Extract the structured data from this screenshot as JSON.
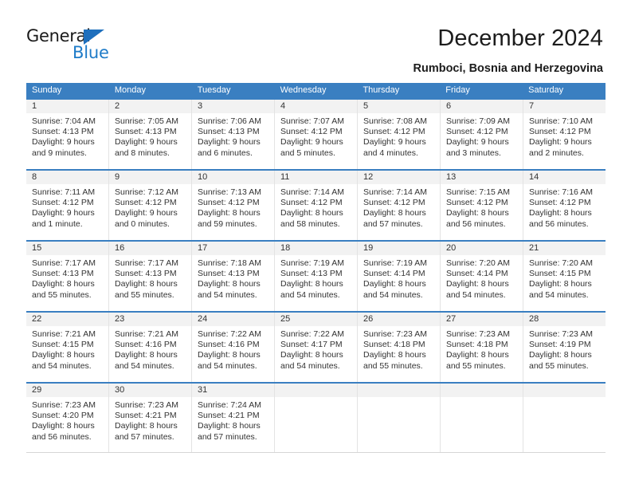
{
  "brand": {
    "name_part1": "General",
    "name_part2": "Blue",
    "triangle_icon": "triangle-icon",
    "colors": {
      "dark": "#1a1a1a",
      "blue": "#1e7bc8"
    }
  },
  "header": {
    "title": "December 2024",
    "subtitle": "Rumboci, Bosnia and Herzegovina"
  },
  "calendar": {
    "accent_color": "#3a7fc1",
    "day_bar_color": "#f2f2f2",
    "weekdays": [
      "Sunday",
      "Monday",
      "Tuesday",
      "Wednesday",
      "Thursday",
      "Friday",
      "Saturday"
    ],
    "weeks": [
      {
        "days": [
          {
            "number": "1",
            "sunrise": "Sunrise: 7:04 AM",
            "sunset": "Sunset: 4:13 PM",
            "daylight_line1": "Daylight: 9 hours",
            "daylight_line2": "and 9 minutes."
          },
          {
            "number": "2",
            "sunrise": "Sunrise: 7:05 AM",
            "sunset": "Sunset: 4:13 PM",
            "daylight_line1": "Daylight: 9 hours",
            "daylight_line2": "and 8 minutes."
          },
          {
            "number": "3",
            "sunrise": "Sunrise: 7:06 AM",
            "sunset": "Sunset: 4:13 PM",
            "daylight_line1": "Daylight: 9 hours",
            "daylight_line2": "and 6 minutes."
          },
          {
            "number": "4",
            "sunrise": "Sunrise: 7:07 AM",
            "sunset": "Sunset: 4:12 PM",
            "daylight_line1": "Daylight: 9 hours",
            "daylight_line2": "and 5 minutes."
          },
          {
            "number": "5",
            "sunrise": "Sunrise: 7:08 AM",
            "sunset": "Sunset: 4:12 PM",
            "daylight_line1": "Daylight: 9 hours",
            "daylight_line2": "and 4 minutes."
          },
          {
            "number": "6",
            "sunrise": "Sunrise: 7:09 AM",
            "sunset": "Sunset: 4:12 PM",
            "daylight_line1": "Daylight: 9 hours",
            "daylight_line2": "and 3 minutes."
          },
          {
            "number": "7",
            "sunrise": "Sunrise: 7:10 AM",
            "sunset": "Sunset: 4:12 PM",
            "daylight_line1": "Daylight: 9 hours",
            "daylight_line2": "and 2 minutes."
          }
        ]
      },
      {
        "days": [
          {
            "number": "8",
            "sunrise": "Sunrise: 7:11 AM",
            "sunset": "Sunset: 4:12 PM",
            "daylight_line1": "Daylight: 9 hours",
            "daylight_line2": "and 1 minute."
          },
          {
            "number": "9",
            "sunrise": "Sunrise: 7:12 AM",
            "sunset": "Sunset: 4:12 PM",
            "daylight_line1": "Daylight: 9 hours",
            "daylight_line2": "and 0 minutes."
          },
          {
            "number": "10",
            "sunrise": "Sunrise: 7:13 AM",
            "sunset": "Sunset: 4:12 PM",
            "daylight_line1": "Daylight: 8 hours",
            "daylight_line2": "and 59 minutes."
          },
          {
            "number": "11",
            "sunrise": "Sunrise: 7:14 AM",
            "sunset": "Sunset: 4:12 PM",
            "daylight_line1": "Daylight: 8 hours",
            "daylight_line2": "and 58 minutes."
          },
          {
            "number": "12",
            "sunrise": "Sunrise: 7:14 AM",
            "sunset": "Sunset: 4:12 PM",
            "daylight_line1": "Daylight: 8 hours",
            "daylight_line2": "and 57 minutes."
          },
          {
            "number": "13",
            "sunrise": "Sunrise: 7:15 AM",
            "sunset": "Sunset: 4:12 PM",
            "daylight_line1": "Daylight: 8 hours",
            "daylight_line2": "and 56 minutes."
          },
          {
            "number": "14",
            "sunrise": "Sunrise: 7:16 AM",
            "sunset": "Sunset: 4:12 PM",
            "daylight_line1": "Daylight: 8 hours",
            "daylight_line2": "and 56 minutes."
          }
        ]
      },
      {
        "days": [
          {
            "number": "15",
            "sunrise": "Sunrise: 7:17 AM",
            "sunset": "Sunset: 4:13 PM",
            "daylight_line1": "Daylight: 8 hours",
            "daylight_line2": "and 55 minutes."
          },
          {
            "number": "16",
            "sunrise": "Sunrise: 7:17 AM",
            "sunset": "Sunset: 4:13 PM",
            "daylight_line1": "Daylight: 8 hours",
            "daylight_line2": "and 55 minutes."
          },
          {
            "number": "17",
            "sunrise": "Sunrise: 7:18 AM",
            "sunset": "Sunset: 4:13 PM",
            "daylight_line1": "Daylight: 8 hours",
            "daylight_line2": "and 54 minutes."
          },
          {
            "number": "18",
            "sunrise": "Sunrise: 7:19 AM",
            "sunset": "Sunset: 4:13 PM",
            "daylight_line1": "Daylight: 8 hours",
            "daylight_line2": "and 54 minutes."
          },
          {
            "number": "19",
            "sunrise": "Sunrise: 7:19 AM",
            "sunset": "Sunset: 4:14 PM",
            "daylight_line1": "Daylight: 8 hours",
            "daylight_line2": "and 54 minutes."
          },
          {
            "number": "20",
            "sunrise": "Sunrise: 7:20 AM",
            "sunset": "Sunset: 4:14 PM",
            "daylight_line1": "Daylight: 8 hours",
            "daylight_line2": "and 54 minutes."
          },
          {
            "number": "21",
            "sunrise": "Sunrise: 7:20 AM",
            "sunset": "Sunset: 4:15 PM",
            "daylight_line1": "Daylight: 8 hours",
            "daylight_line2": "and 54 minutes."
          }
        ]
      },
      {
        "days": [
          {
            "number": "22",
            "sunrise": "Sunrise: 7:21 AM",
            "sunset": "Sunset: 4:15 PM",
            "daylight_line1": "Daylight: 8 hours",
            "daylight_line2": "and 54 minutes."
          },
          {
            "number": "23",
            "sunrise": "Sunrise: 7:21 AM",
            "sunset": "Sunset: 4:16 PM",
            "daylight_line1": "Daylight: 8 hours",
            "daylight_line2": "and 54 minutes."
          },
          {
            "number": "24",
            "sunrise": "Sunrise: 7:22 AM",
            "sunset": "Sunset: 4:16 PM",
            "daylight_line1": "Daylight: 8 hours",
            "daylight_line2": "and 54 minutes."
          },
          {
            "number": "25",
            "sunrise": "Sunrise: 7:22 AM",
            "sunset": "Sunset: 4:17 PM",
            "daylight_line1": "Daylight: 8 hours",
            "daylight_line2": "and 54 minutes."
          },
          {
            "number": "26",
            "sunrise": "Sunrise: 7:23 AM",
            "sunset": "Sunset: 4:18 PM",
            "daylight_line1": "Daylight: 8 hours",
            "daylight_line2": "and 55 minutes."
          },
          {
            "number": "27",
            "sunrise": "Sunrise: 7:23 AM",
            "sunset": "Sunset: 4:18 PM",
            "daylight_line1": "Daylight: 8 hours",
            "daylight_line2": "and 55 minutes."
          },
          {
            "number": "28",
            "sunrise": "Sunrise: 7:23 AM",
            "sunset": "Sunset: 4:19 PM",
            "daylight_line1": "Daylight: 8 hours",
            "daylight_line2": "and 55 minutes."
          }
        ]
      },
      {
        "days": [
          {
            "number": "29",
            "sunrise": "Sunrise: 7:23 AM",
            "sunset": "Sunset: 4:20 PM",
            "daylight_line1": "Daylight: 8 hours",
            "daylight_line2": "and 56 minutes."
          },
          {
            "number": "30",
            "sunrise": "Sunrise: 7:23 AM",
            "sunset": "Sunset: 4:21 PM",
            "daylight_line1": "Daylight: 8 hours",
            "daylight_line2": "and 57 minutes."
          },
          {
            "number": "31",
            "sunrise": "Sunrise: 7:24 AM",
            "sunset": "Sunset: 4:21 PM",
            "daylight_line1": "Daylight: 8 hours",
            "daylight_line2": "and 57 minutes."
          },
          {
            "number": "",
            "sunrise": "",
            "sunset": "",
            "daylight_line1": "",
            "daylight_line2": ""
          },
          {
            "number": "",
            "sunrise": "",
            "sunset": "",
            "daylight_line1": "",
            "daylight_line2": ""
          },
          {
            "number": "",
            "sunrise": "",
            "sunset": "",
            "daylight_line1": "",
            "daylight_line2": ""
          },
          {
            "number": "",
            "sunrise": "",
            "sunset": "",
            "daylight_line1": "",
            "daylight_line2": ""
          }
        ]
      }
    ]
  }
}
